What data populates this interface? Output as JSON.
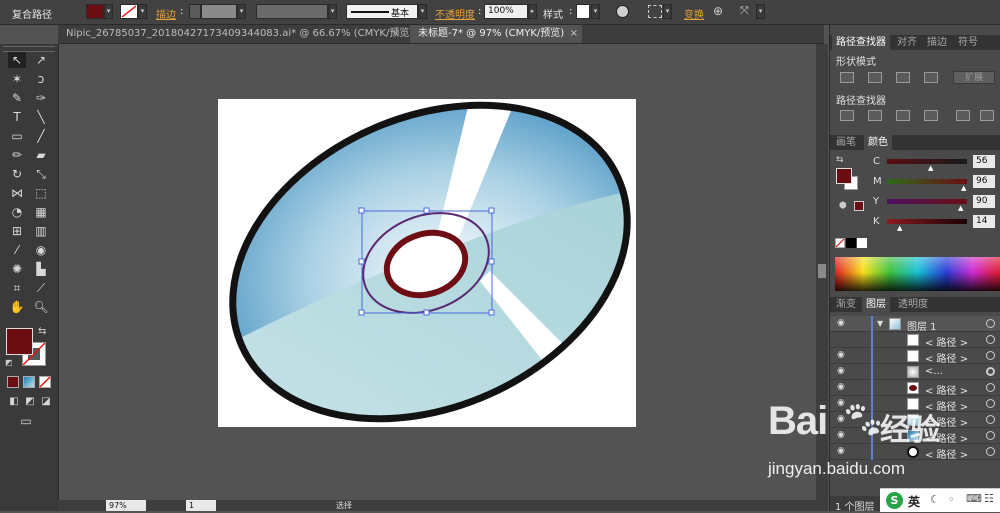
{
  "control_bar": {
    "object_type": "复合路径",
    "stroke_label": "描边",
    "stroke_style_label": "基本",
    "opacity_label": "不透明度",
    "opacity_value": "100%",
    "style_label": "样式",
    "transform_label": "变换",
    "fill_color": "#6b0e14"
  },
  "tabs": [
    {
      "label": "Nipic_26785037_20180427173409344083.ai* @ 66.67% (CMYK/预览)",
      "active": false
    },
    {
      "label": "未标题-7* @ 97% (CMYK/预览)",
      "active": true
    }
  ],
  "pathfinder": {
    "tabs": [
      "路径查找器",
      "对齐",
      "描边",
      "符号"
    ],
    "shape_modes_label": "形状模式",
    "expand_label": "扩展",
    "pathfinders_label": "路径查找器"
  },
  "color": {
    "tabs": [
      "画笔",
      "颜色"
    ],
    "channels": [
      {
        "name": "C",
        "value": "56"
      },
      {
        "name": "M",
        "value": "96"
      },
      {
        "name": "Y",
        "value": "90"
      },
      {
        "name": "K",
        "value": "14"
      }
    ],
    "fill_color": "#6b0e14"
  },
  "layers": {
    "tabs": [
      "渐变",
      "图层",
      "透明度"
    ],
    "rows": [
      {
        "name": "图层 1",
        "top": true
      },
      {
        "name": "< 路径 >"
      },
      {
        "name": "< 路径 >"
      },
      {
        "name": "<..."
      },
      {
        "name": "< 路径 >"
      },
      {
        "name": "< 路径 >"
      },
      {
        "name": "< 路径 >"
      },
      {
        "name": "< 路径 >"
      },
      {
        "name": "< 路径 >"
      }
    ],
    "layer_count": "1 个图层"
  },
  "status": {
    "zoom": "97%",
    "page": "1",
    "tool": "选择"
  },
  "watermark": {
    "brand": "Bai",
    "brand_cn": "经验",
    "url": "jingyan.baidu.com"
  },
  "ime": {
    "label": "英"
  }
}
